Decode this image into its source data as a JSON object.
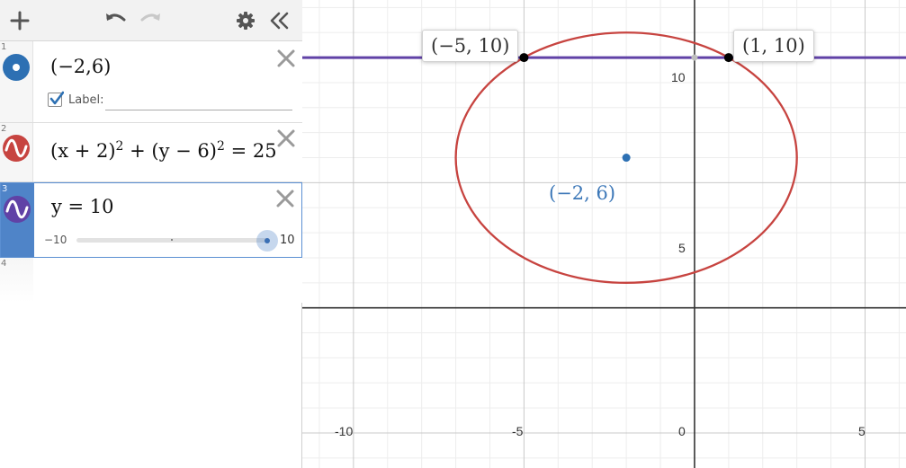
{
  "toolbar": {
    "add_icon": "plus-icon",
    "undo_icon": "undo-icon",
    "redo_icon": "redo-icon",
    "settings_icon": "gear-icon",
    "collapse_icon": "double-chevron-left-icon"
  },
  "expressions": [
    {
      "number": "1",
      "icon": "point-icon",
      "color": "#2d70b3",
      "text": "(−2,6)",
      "label_checkbox_checked": true,
      "label_text": "Label:",
      "label_value": ""
    },
    {
      "number": "2",
      "icon": "wave-icon",
      "color": "#c74440",
      "text_parts": [
        "(x + 2)",
        "2",
        " + (y − 6)",
        "2",
        " = 25"
      ]
    },
    {
      "number": "3",
      "icon": "wave-icon",
      "color": "#6042a6",
      "text": "y = 10",
      "slider": {
        "min": "−10",
        "max": "10",
        "value": 10
      }
    },
    {
      "number": "4"
    }
  ],
  "graph": {
    "x_ticks": [
      "-10",
      "-5",
      "0",
      "5"
    ],
    "y_ticks": [
      "5",
      "10"
    ],
    "tooltips": [
      "(−5, 10)",
      "(1, 10)"
    ],
    "point_label": "(−2, 6)",
    "colors": {
      "circle": "#c74440",
      "line": "#6042a6",
      "point": "#2d70b3"
    }
  },
  "chart_data": {
    "type": "scatter",
    "xlim": [
      -11.5,
      6.2
    ],
    "ylim": [
      -6.4,
      12.3
    ],
    "grid": true,
    "curves": [
      {
        "equation": "(x + 2)^2 + (y - 6)^2 = 25",
        "kind": "circle",
        "center": [
          -2,
          6
        ],
        "radius": 5,
        "color": "#c74440"
      },
      {
        "equation": "y = 10",
        "kind": "horizontal-line",
        "y": 10,
        "color": "#6042a6"
      }
    ],
    "points": [
      {
        "x": -2,
        "y": 6,
        "label": "(−2, 6)",
        "color": "#2d70b3"
      },
      {
        "x": -5,
        "y": 10,
        "label": "(−5, 10)",
        "color": "#000000"
      },
      {
        "x": 1,
        "y": 10,
        "label": "(1, 10)",
        "color": "#000000"
      }
    ]
  }
}
